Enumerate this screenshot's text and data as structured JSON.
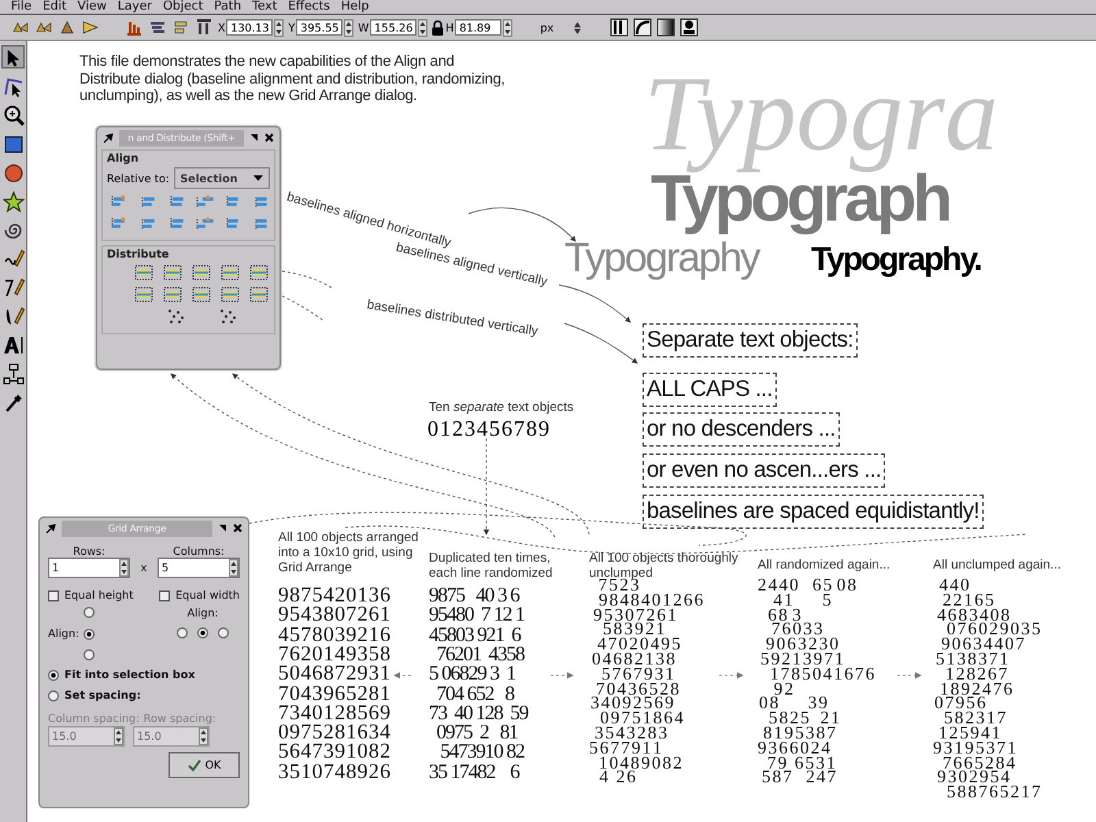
{
  "menu": [
    "File",
    "Edit",
    "View",
    "Layer",
    "Object",
    "Path",
    "Text",
    "Effects",
    "Help"
  ],
  "toolbar": {
    "fields": [
      {
        "label": "X",
        "value": "130.13"
      },
      {
        "label": "Y",
        "value": "395.55"
      },
      {
        "label": "W",
        "value": "155.26"
      },
      {
        "label": "H",
        "value": "81.89"
      }
    ],
    "unit": "px"
  },
  "toolbox": [
    {
      "kind": "selector",
      "selected": true
    },
    {
      "kind": "node",
      "selected": false
    },
    {
      "kind": "zoom",
      "selected": false
    },
    {
      "kind": "rect",
      "selected": false
    },
    {
      "kind": "ellipse",
      "selected": false
    },
    {
      "kind": "star",
      "selected": false
    },
    {
      "kind": "spiral",
      "selected": false
    },
    {
      "kind": "pencil",
      "selected": false
    },
    {
      "kind": "pen",
      "selected": false
    },
    {
      "kind": "calligraphy",
      "selected": false
    },
    {
      "kind": "text",
      "selected": false
    },
    {
      "kind": "connector",
      "selected": false
    },
    {
      "kind": "dropper",
      "selected": false
    }
  ],
  "canvas": {
    "intro": "This file demonstrates the new capabilities of the Align and Distribute dialog (baseline alignment and distribution, randomizing, unclumping), as well as the new Grid Arrange dialog.",
    "typography": [
      {
        "kind": "italic",
        "text": "Typogra"
      },
      {
        "kind": "heavy",
        "text": "Typograph"
      },
      {
        "kind": "thin",
        "text": "Typography"
      },
      {
        "kind": "bold",
        "text": "Typography."
      }
    ],
    "text_objects": [
      "Separate text objects:",
      "ALL CAPS ...",
      "or no descenders ...",
      "or even no ascen...ers ...",
      "baselines are spaced equidistantly!"
    ],
    "annotations": [
      "baselines aligned horizontally",
      "baselines aligned vertically",
      "baselines distributed vertically"
    ],
    "ten_objects": {
      "caption": "Ten *separate* text objects",
      "digits": "0123456789"
    },
    "columns": [
      {
        "kind": "grid",
        "caption": "All 100 objects arranged into a 10x10 grid, using Grid Arrange",
        "lines": [
          "9875420136",
          "9543807261",
          "4578039216",
          "7620149358",
          "5046872931",
          "7043965281",
          "7340128569",
          "0975281634",
          "5647391082",
          "3510748926"
        ]
      },
      {
        "kind": "rows",
        "caption": "Duplicated ten times, each line randomized",
        "lines": [
          "9875   40 3 6",
          "95480  7 12 1",
          "45803 921  6",
          "  76201  4358",
          "5 06829 3  1",
          "  704 652   8",
          "73  40 128  59",
          "  0975  2   81",
          "   5473910 82",
          "35 17482    6"
        ]
      },
      {
        "kind": "scatter",
        "caption": "All 100 objects thoroughly unclumped",
        "lines": [
          "   7 5 2 3",
          "9 8 4 8 4 0 1 2 6 6",
          "9 5 3 0 7 2 6 1",
          "5 8 3 9 2 1",
          "4 7 0 2 0 4 9 5",
          "0 4 6 8 2 1 3 8",
          "5 7 6 7 9 3 1",
          "7 0 4 3 6 5 2 8",
          "3 4 0 9 2 5 6 9",
          "0 9 7 5 1 8 6 4",
          "3 5 4 3 2 8 3",
          "5 6 7 7 9 1 1",
          "1 0 4 8 9 0 8 2",
          "  4   2 6"
        ]
      },
      {
        "kind": "scatter",
        "caption": "All randomized again...",
        "lines": [
          "2 4 4 0     6 5  0 8",
          "  4 1          5",
          "  6 8  3",
          "7 6 0 3 3",
          "9 0 6 3 2 3 0",
          "5 9 2 1 3 9 7 1",
          "1 7 8 5 0 4 1 6 7 6",
          "   9 2",
          "0 8          3 9",
          "5 8 2 5    2 1",
          "8 1 9 5 3 8 7",
          "9 3 6 6 0 2 4",
          "7 9   6 5 3 1",
          "5 8 7     2 4 7"
        ]
      },
      {
        "kind": "scatter",
        "caption": "All unclumped again...",
        "lines": [
          "  4 4 0",
          "2 2 1 6 5",
          "4 6 8 3 4 0 8",
          "0 7 6 0 2 9 0 3 5",
          "9 0 6 3 4 4 0 7",
          "5 1 3 8 3 7 1",
          "1 2 8 2 6 7",
          "1 8 9 2 4 7 6",
          "0 7 9 5 6",
          "5 8 2 3 1 7",
          "1 2 5 9 4 1",
          "9 3 1 9 5 3 7 1",
          "7 6 6 5 2 8 4",
          "9 3 0 2 9 5 4",
          "5 8 8 7 6 5 2 1 7"
        ]
      }
    ]
  },
  "align_dialog": {
    "title": "n and Distribute (Shift+",
    "align_label": "Align",
    "relative_label": "Relative to:",
    "relative_value": "Selection",
    "distribute_label": "Distribute"
  },
  "grid_dialog": {
    "title": "Grid Arrange",
    "rows": {
      "label": "Rows:",
      "value": "1"
    },
    "columns": {
      "label": "Columns:",
      "value": "5"
    },
    "times": "x",
    "checks": [
      {
        "label": "Equal height",
        "checked": false
      },
      {
        "label": "Equal width",
        "checked": false
      }
    ],
    "row_align": {
      "label": "Align:",
      "options": [
        {
          "selected": false
        },
        {
          "selected": true
        },
        {
          "selected": false
        }
      ]
    },
    "col_align": {
      "label": "Align:",
      "options": [
        {
          "selected": false
        },
        {
          "selected": true
        },
        {
          "selected": false
        }
      ]
    },
    "modes": [
      {
        "label": "Fit into selection box",
        "selected": true
      },
      {
        "label": "Set spacing:",
        "selected": false
      }
    ],
    "spacing": [
      {
        "label": "Column spacing:",
        "value": "15.0",
        "disabled": true
      },
      {
        "label": "Row spacing:",
        "value": "15.0",
        "disabled": true
      }
    ],
    "ok": "OK"
  }
}
